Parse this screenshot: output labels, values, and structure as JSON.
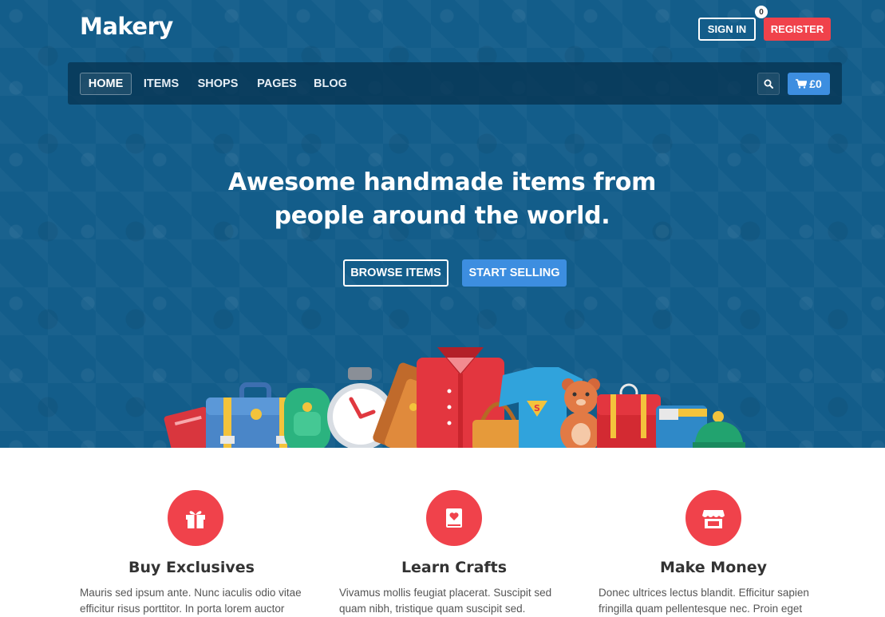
{
  "brand": {
    "name": "Makery"
  },
  "auth": {
    "signin_label": "SIGN IN",
    "register_label": "REGISTER"
  },
  "nav": {
    "items": [
      {
        "label": "HOME"
      },
      {
        "label": "ITEMS"
      },
      {
        "label": "SHOPS"
      },
      {
        "label": "PAGES"
      },
      {
        "label": "BLOG"
      }
    ],
    "cart_total": "£0",
    "cart_count": "0",
    "search_icon": "search-icon",
    "cart_icon": "cart-icon"
  },
  "hero": {
    "headline_line1": "Awesome handmade items from",
    "headline_line2": "people around the world.",
    "browse_label": "BROWSE ITEMS",
    "sell_label": "START SELLING"
  },
  "features": [
    {
      "icon": "gift-icon",
      "title": "Buy Exclusives",
      "text": "Mauris sed ipsum ante. Nunc iaculis odio vitae efficitur risus porttitor. In porta lorem auctor"
    },
    {
      "icon": "book-heart-icon",
      "title": "Learn Crafts",
      "text": "Vivamus mollis feugiat placerat. Suscipit sed quam nibh, tristique quam suscipit sed."
    },
    {
      "icon": "shop-icon",
      "title": "Make Money",
      "text": "Donec ultrices lectus blandit. Efficitur sapien fringilla quam pellentesque nec. Proin eget"
    }
  ],
  "colors": {
    "hero_bg": "#135d8a",
    "accent_red": "#f0424b",
    "accent_blue": "#3d8ee0"
  }
}
